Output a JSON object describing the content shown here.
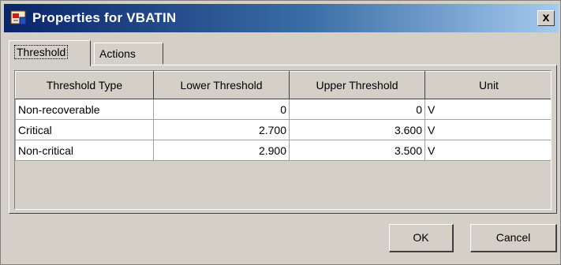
{
  "window": {
    "title": "Properties for VBATIN",
    "close_label": "x"
  },
  "tabs": [
    {
      "label": "Threshold",
      "active": true
    },
    {
      "label": "Actions",
      "active": false
    }
  ],
  "table": {
    "columns": [
      "Threshold Type",
      "Lower Threshold",
      "Upper Threshold",
      "Unit"
    ],
    "rows": [
      [
        "Non-recoverable",
        "0",
        "0",
        "V"
      ],
      [
        "Critical",
        "2.700",
        "3.600",
        "V"
      ],
      [
        "Non-critical",
        "2.900",
        "3.500",
        "V"
      ]
    ]
  },
  "buttons": {
    "ok_label": "OK",
    "cancel_label": "Cancel"
  },
  "colors": {
    "title_gradient_start": "#0a246a",
    "title_gradient_end": "#a6caf0",
    "window_background": "#d4d0c8"
  },
  "icons": {
    "title_icon": "properties-app-icon",
    "close_icon": "close-icon"
  }
}
